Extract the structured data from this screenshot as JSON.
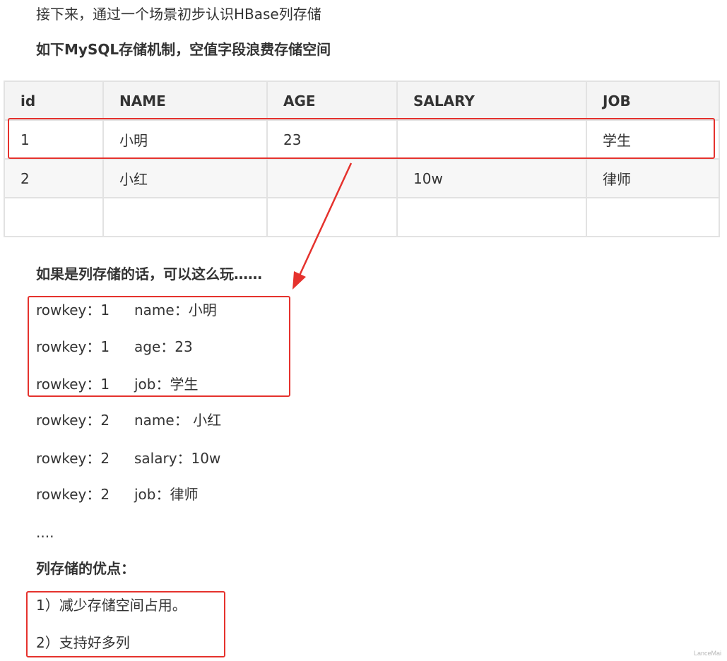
{
  "intro": "接下来，通过一个场景初步认识HBase列存储",
  "heading_mysql": "如下MySQL存储机制，空值字段浪费存储空间",
  "table": {
    "headers": [
      "id",
      "NAME",
      "AGE",
      "SALARY",
      "JOB"
    ],
    "rows": [
      [
        "1",
        "小明",
        "23",
        "",
        "学生"
      ],
      [
        "2",
        "小红",
        "",
        "10w",
        "律师"
      ],
      [
        "",
        "",
        "",
        "",
        ""
      ]
    ]
  },
  "heading_column": "如果是列存储的话，可以这么玩……",
  "kv_lines": [
    {
      "k": "rowkey：1",
      "v": "name：小明"
    },
    {
      "k": "rowkey：1",
      "v": "age：23"
    },
    {
      "k": "rowkey：1",
      "v": "job：学生"
    },
    {
      "k": "rowkey：2",
      "v": "name： 小红"
    },
    {
      "k": "rowkey：2",
      "v": "salary：10w"
    },
    {
      "k": "rowkey：2",
      "v": "job：律师"
    }
  ],
  "ellipsis": "....",
  "heading_advantages": "列存储的优点：",
  "advantages": [
    "1）减少存储空间占用。",
    "2）支持好多列"
  ],
  "watermark": "LanceMai",
  "colors": {
    "highlight": "#e5322d",
    "text": "#333333",
    "table_border": "#e2e2e2",
    "header_bg": "#f4f4f4"
  }
}
